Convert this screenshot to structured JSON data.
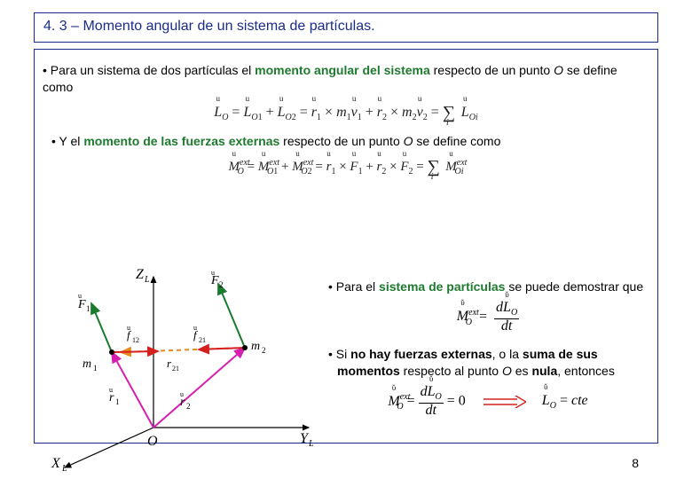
{
  "title": "4. 3 – Momento angular de un sistema de partículas.",
  "bullets": {
    "b1_pre": "Para un sistema de dos partículas el ",
    "b1_green": "momento angular del sistema",
    "b1_mid": " respecto de un punto ",
    "b1_O": "O",
    "b1_post": " se define como",
    "b2_pre": "Y el ",
    "b2_green": "momento de las fuerzas externas",
    "b2_mid": " respecto de un punto ",
    "b2_O": "O",
    "b2_post": " se define como",
    "b3_pre": "Para el ",
    "b3_green": "sistema de partículas",
    "b3_post": " se puede demostrar que",
    "b4_pre": "Si ",
    "b4_strong1": "no hay fuerzas externas",
    "b4_mid": ", o la ",
    "b4_strong2": "suma de sus momentos",
    "b4_mid2": " respecto al punto ",
    "b4_O": "O",
    "b4_mid3": " es ",
    "b4_strong3": "nula",
    "b4_post": ", entonces"
  },
  "equations": {
    "eq1": "L→O = L→O₁ + L→O₂ = r→₁ × m₁v→₁ + r→₂ × m₂v→₂ = Σᵢ L→Oᵢ",
    "eq2": "M→Oᵉˣᵗ = M→O₁ᵉˣᵗ + M→O₂ᵉˣᵗ = r→₁ × F→₁ + r→₂ × F→₂ = Σᵢ M→Oᵢᵉˣᵗ",
    "eq3_lhs": "M→Oᵉˣᵗ",
    "eq3_rhs_num": "dL→O",
    "eq3_rhs_den": "dt",
    "eq4_lhs": "M→Oᵉˣᵗ",
    "eq4_mid_num": "dL→O",
    "eq4_mid_den": "dt",
    "eq4_zero": "= 0",
    "eq4_rhs": "L→O = cte"
  },
  "diagram": {
    "axes": {
      "z": "Z_L",
      "x": "X_L",
      "y": "Y_L",
      "origin": "O"
    },
    "labels": {
      "F1": "F→₁",
      "F2": "F→₂",
      "f12": "f→₁₂",
      "f21": "f→₂₁",
      "m1": "m₁",
      "m2": "m₂",
      "r1": "r→₁",
      "r2": "r→₂",
      "r21": "r→₂₁"
    }
  },
  "page_number": "8"
}
